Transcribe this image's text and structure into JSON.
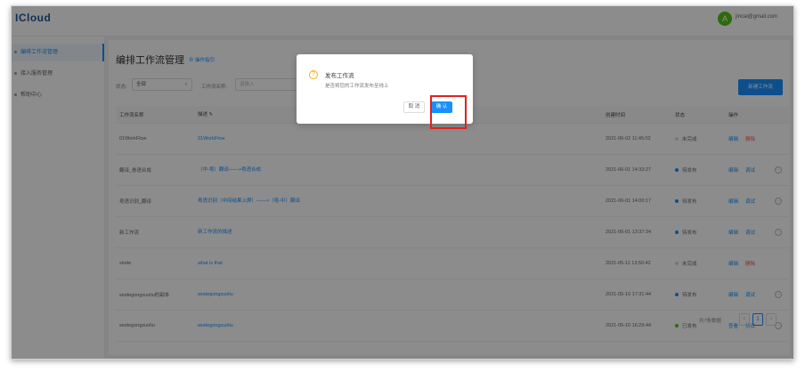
{
  "app": {
    "logo": "ICloud",
    "user_initial": "A",
    "user_name": "jincai@gmail.com"
  },
  "sidebar": {
    "items": [
      {
        "label": "编排工作流管理",
        "active": true
      },
      {
        "label": "接入服务管理",
        "active": false
      },
      {
        "label": "帮助中心",
        "active": false
      }
    ]
  },
  "page": {
    "title": "编排工作流管理",
    "guide": "⊕ 操作指引"
  },
  "filters": {
    "status_label": "状态:",
    "status_value": "全部",
    "name_label": "工作流名称:",
    "name_placeholder": "请输入"
  },
  "new_button": "新建工作流",
  "table": {
    "headers": {
      "name": "工作流名称",
      "desc": "描述 ✎",
      "time": "创建时间",
      "status": "状态",
      "ops": "操作"
    },
    "rows": [
      {
        "name": "01WorkFlow",
        "desc": "01WorkFlow",
        "time": "2021-06-02 11:45:02",
        "status": "未完成",
        "dot": "gray",
        "ops": [
          "编辑",
          "删除"
        ],
        "more": false
      },
      {
        "name": "翻译_卷语合成",
        "desc": "（中-粤）翻译——>粤语合成",
        "time": "2021-06-01 14:33:27",
        "status": "待发布",
        "dot": "blue",
        "ops": [
          "编辑",
          "调试"
        ],
        "more": true
      },
      {
        "name": "粤语识别_翻译",
        "desc": "粤语识别（中间结果上屏）——>（粤-中）翻译",
        "time": "2021-06-01 14:00:17",
        "status": "待发布",
        "dot": "blue",
        "ops": [
          "编辑",
          "调试"
        ],
        "more": true
      },
      {
        "name": "新工作流",
        "desc": "新工作流的描述",
        "time": "2021-06-01 13:37:34",
        "status": "待发布",
        "dot": "blue",
        "ops": [
          "编辑",
          "调试"
        ],
        "more": true
      },
      {
        "name": "xinde",
        "desc": "what is that",
        "time": "2021-05-11 13:50:42",
        "status": "未完成",
        "dot": "gray",
        "ops": [
          "编辑",
          "删除"
        ],
        "more": false
      },
      {
        "name": "wodegongzuoliu的副本",
        "desc": "wodegongzuoliu",
        "time": "2021-05-10 17:31:44",
        "status": "待发布",
        "dot": "blue",
        "ops": [
          "编辑",
          "调试"
        ],
        "more": true
      },
      {
        "name": "wodegongzuoliu",
        "desc": "wodegongzuoliu",
        "time": "2021-05-10 16:29:44",
        "status": "已发布",
        "dot": "green",
        "ops": [
          "查看",
          "协议"
        ],
        "more": true
      }
    ]
  },
  "pagination": {
    "total": "共7条数据",
    "page": "1",
    "prev": "<",
    "next": ">"
  },
  "dialog": {
    "icon": "?",
    "title": "发布工作流",
    "content": "是否将您的工作流发布至线上",
    "cancel": "取 消",
    "ok": "确 认"
  },
  "colors": {
    "primary": "#1890ff",
    "danger": "#ff4d4f",
    "warning": "#faad14",
    "success": "#52c41a",
    "highlight": "#e02020"
  }
}
